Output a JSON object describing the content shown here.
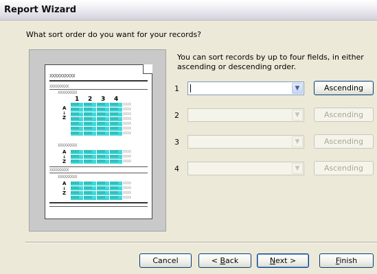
{
  "window": {
    "title": "Report Wizard"
  },
  "prompt": "What sort order do you want for your records?",
  "info": "You can sort records by up to four fields, in either ascending or descending order.",
  "preview": {
    "header_placeholder": "XXXXXXXXXX",
    "group1_placeholder": "XXXXXXXXX",
    "group2_placeholder": "XXXXXXXXX",
    "group3_placeholder": "XXXXXXXXX",
    "col_numbers": [
      "1",
      "2",
      "3",
      "4"
    ],
    "cell_text": "XXXX",
    "sort_glyph_a": "A",
    "sort_glyph_z": "Z"
  },
  "sort_fields": [
    {
      "number": "1",
      "value": "",
      "order": "Ascending",
      "enabled": true
    },
    {
      "number": "2",
      "value": "",
      "order": "Ascending",
      "enabled": false
    },
    {
      "number": "3",
      "value": "",
      "order": "Ascending",
      "enabled": false
    },
    {
      "number": "4",
      "value": "",
      "order": "Ascending",
      "enabled": false
    }
  ],
  "buttons": {
    "cancel": "Cancel",
    "back_prefix": "< ",
    "back_accel": "B",
    "back_rest": "ack",
    "next_accel": "N",
    "next_rest": "ext >",
    "finish_accel": "F",
    "finish_rest": "inish"
  },
  "icons": {
    "dropdown": "chevron-down-icon"
  }
}
